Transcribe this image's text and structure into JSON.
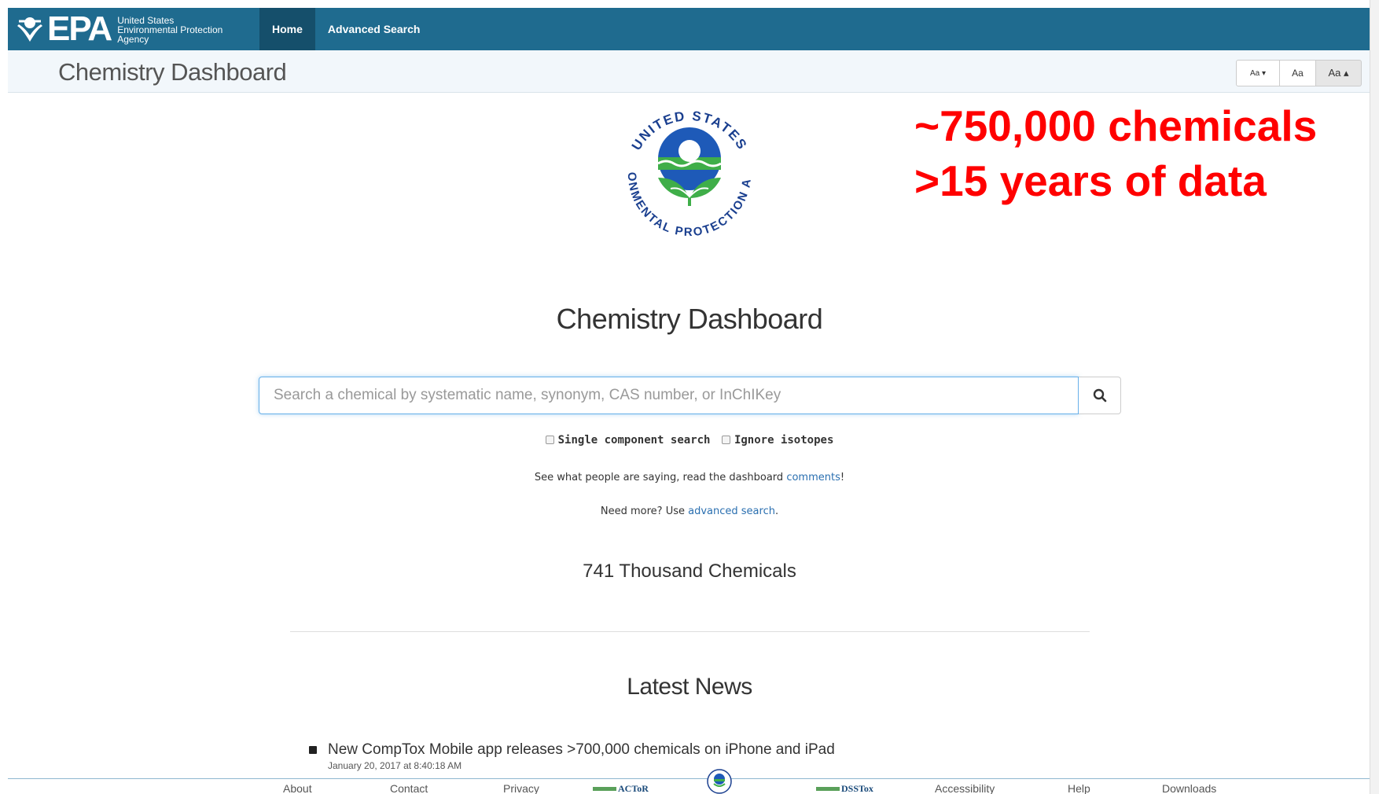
{
  "header": {
    "logo_text": "EPA",
    "agency_name_line1": "United States",
    "agency_name_line2": "Environmental Protection",
    "agency_name_line3": "Agency",
    "nav": [
      {
        "label": "Home",
        "active": true
      },
      {
        "label": "Advanced Search",
        "active": false
      }
    ]
  },
  "titlebar": {
    "title": "Chemistry Dashboard",
    "font_buttons": [
      "Aa ▾",
      "Aa",
      "Aa ▴"
    ]
  },
  "seal": {
    "top_text": "UNITED STATES",
    "side_text": "ENVIRONMENTAL PROTECTION AGENCY"
  },
  "overlay": {
    "line1": "~750,000 chemicals",
    "line2": ">15 years of data",
    "color": "#ff0000"
  },
  "main": {
    "title": "Chemistry Dashboard",
    "search_placeholder": "Search a chemical by systematic name, synonym, CAS number, or InChIKey",
    "search_icon": "search-icon",
    "option1": "Single component search",
    "option2": "Ignore isotopes",
    "comments_prefix": "See what people are saying, read the dashboard ",
    "comments_link": "comments",
    "comments_suffix": "!",
    "advanced_prefix": "Need more? Use ",
    "advanced_link": "advanced search",
    "advanced_suffix": ".",
    "chemical_count": "741 Thousand Chemicals"
  },
  "news": {
    "title": "Latest News",
    "items": [
      {
        "text": "New CompTox Mobile app releases >700,000 chemicals on iPhone and iPad",
        "date": "January 20, 2017 at 8:40:18 AM"
      }
    ]
  },
  "footer": {
    "links": [
      "About",
      "Contact",
      "Privacy",
      "Accessibility",
      "Help",
      "Downloads"
    ],
    "logos": [
      "ACToR",
      "DSSTox"
    ]
  },
  "colors": {
    "nav_bg": "#1f6b8f",
    "nav_active": "#154f6b",
    "link": "#2a6fb0"
  }
}
